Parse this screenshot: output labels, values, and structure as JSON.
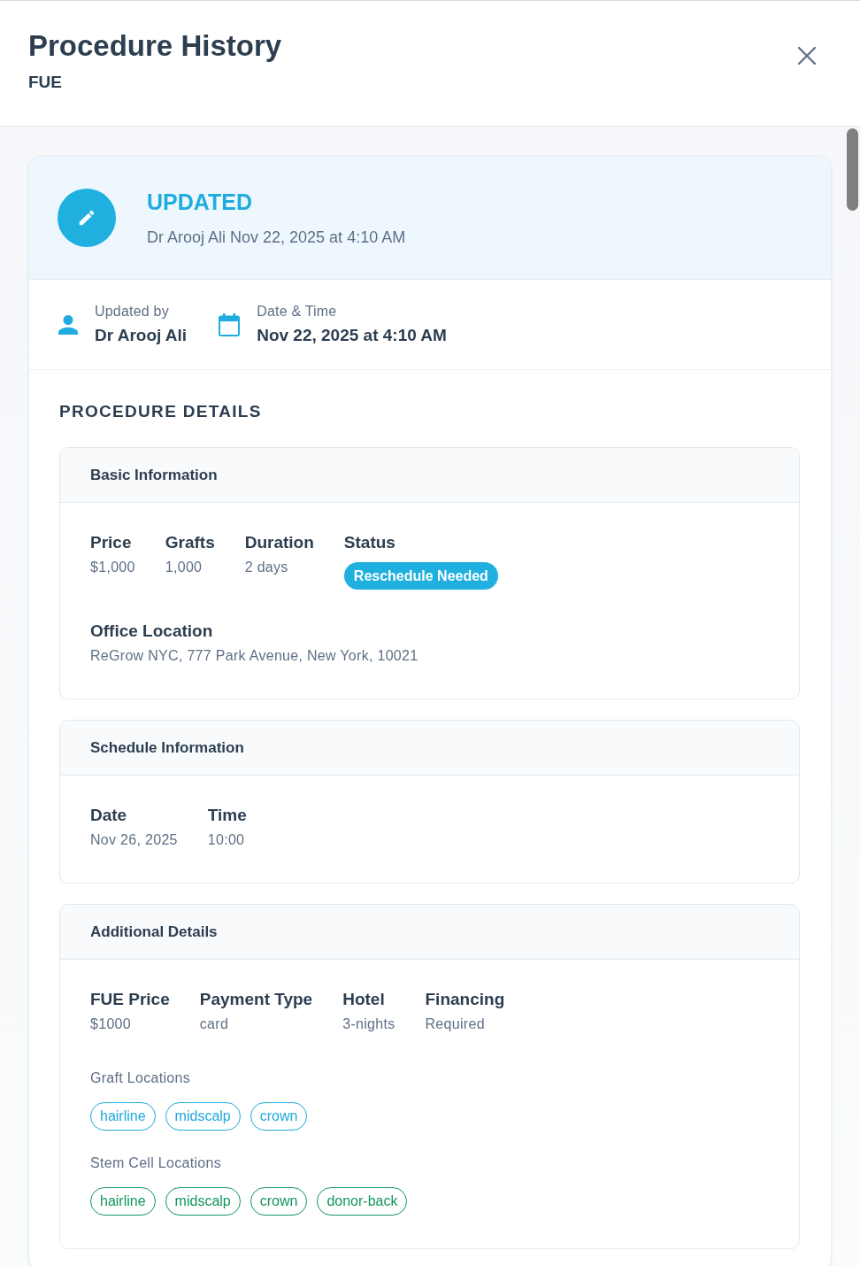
{
  "header": {
    "title": "Procedure History",
    "subtitle": "FUE"
  },
  "event": {
    "type": "UPDATED",
    "summary": "Dr Arooj Ali Nov 22, 2025 at 4:10 AM"
  },
  "meta": [
    {
      "kind": "person",
      "label": "Updated by",
      "value": "Dr Arooj Ali"
    },
    {
      "kind": "calendar",
      "label": "Date & Time",
      "value": "Nov 22, 2025 at 4:10 AM"
    }
  ],
  "details_title": "PROCEDURE DETAILS",
  "sections": [
    {
      "title": "Basic Information",
      "rows": [
        [
          {
            "kind": "text",
            "label": "Price",
            "value": "$1,000"
          },
          {
            "kind": "text",
            "label": "Grafts",
            "value": "1,000"
          },
          {
            "kind": "text",
            "label": "Duration",
            "value": "2 days"
          },
          {
            "kind": "badge",
            "label": "Status",
            "value": "Reschedule Needed"
          }
        ],
        [
          {
            "kind": "text",
            "label": "Office Location",
            "value": "ReGrow NYC, 777 Park Avenue, New York, 10021"
          }
        ]
      ]
    },
    {
      "title": "Schedule Information",
      "rows": [
        [
          {
            "kind": "text",
            "label": "Date",
            "value": "Nov 26, 2025"
          },
          {
            "kind": "text",
            "label": "Time",
            "value": "10:00"
          }
        ]
      ]
    },
    {
      "title": "Additional Details",
      "rows": [
        [
          {
            "kind": "text",
            "label": "FUE Price",
            "value": "$1000"
          },
          {
            "kind": "text",
            "label": "Payment Type",
            "value": "card"
          },
          {
            "kind": "text",
            "label": "Hotel",
            "value": "3-nights"
          },
          {
            "kind": "text",
            "label": "Financing",
            "value": "Required"
          }
        ]
      ],
      "tag_groups": [
        {
          "label": "Graft Locations",
          "color": "#1fa9dc",
          "tags": [
            "hairline",
            "midscalp",
            "crown"
          ]
        },
        {
          "label": "Stem Cell Locations",
          "color": "#12965b",
          "tags": [
            "hairline",
            "midscalp",
            "crown",
            "donor-back"
          ]
        }
      ]
    }
  ]
}
